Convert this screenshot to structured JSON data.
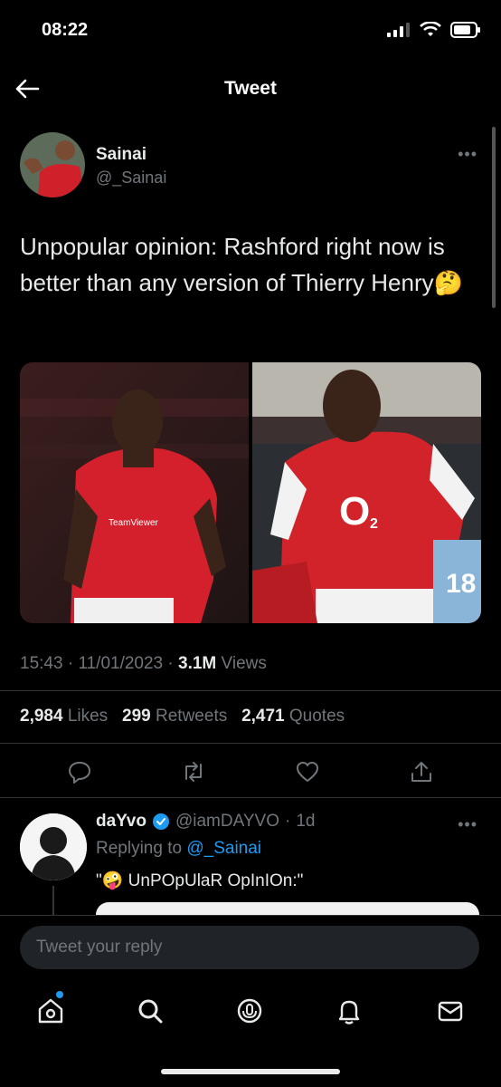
{
  "status_bar": {
    "time": "08:22"
  },
  "header": {
    "title": "Tweet"
  },
  "tweet": {
    "author_name": "Sainai",
    "author_handle": "@_Sainai",
    "more_label": "•••",
    "text": "Unpopular opinion: Rashford right now is better than any version of Thierry Henry🤔",
    "time": "15:43",
    "date": "11/01/2023",
    "views_count": "3.1M",
    "views_label": "Views",
    "likes_count": "2,984",
    "likes_label": "Likes",
    "retweets_count": "299",
    "retweets_label": "Retweets",
    "quotes_count": "2,471",
    "quotes_label": "Quotes",
    "jersey_sponsor_left": "TeamViewer",
    "jersey_sponsor_right": "O",
    "jersey_sponsor_right_sub": "2",
    "jersey_number": "18"
  },
  "reply": {
    "author_name": "daYvo",
    "author_handle": "@iamDAYVO",
    "age": "1d",
    "replying_prefix": "Replying to",
    "replying_to": "@_Sainai",
    "text": "\"🤪 UnPOpUlaR OpInIOn:\""
  },
  "composer": {
    "placeholder": "Tweet your reply"
  },
  "colors": {
    "accent": "#1d9bf0",
    "background": "#000000",
    "secondary_text": "#71767b"
  },
  "icons": {
    "actions": [
      "reply-icon",
      "retweet-icon",
      "like-icon",
      "share-icon"
    ],
    "nav": [
      "home-icon",
      "search-icon",
      "spaces-icon",
      "notifications-icon",
      "messages-icon"
    ]
  }
}
